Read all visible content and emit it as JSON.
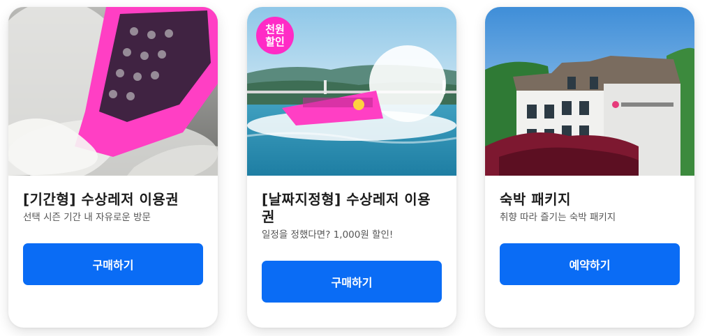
{
  "cards": [
    {
      "title": "[기간형] 수상레저 이용권",
      "subtitle": "선택 시즌 기간 내 자유로운 방문",
      "button_label": "구매하기",
      "image_icon": "speedboat-splash-photo"
    },
    {
      "badge_line1": "천원",
      "badge_line2": "할인",
      "title": "[날짜지정형] 수상레저 이용권",
      "subtitle": "일정을 정했다면? 1,000원 할인!",
      "button_label": "구매하기",
      "image_icon": "speedboat-lake-photo"
    },
    {
      "title": "숙박 패키지",
      "subtitle": "취향 따라 즐기는 숙박 패키지",
      "button_label": "예약하기",
      "image_icon": "lodge-building-photo"
    }
  ],
  "colors": {
    "accent": "#0a6cf5",
    "badge": "#ff2bc6",
    "boat": "#ff3fc4"
  }
}
